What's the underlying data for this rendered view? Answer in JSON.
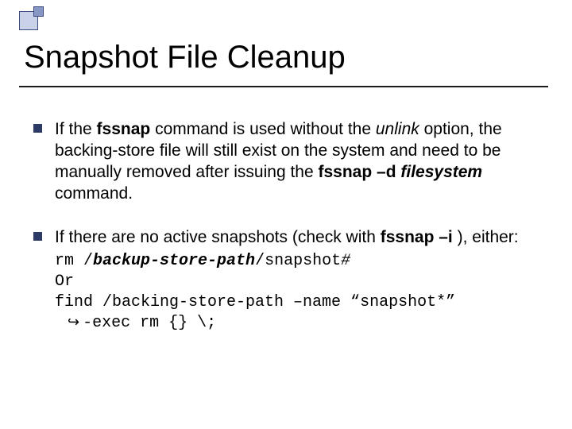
{
  "title": "Snapshot File Cleanup",
  "bullets": [
    {
      "runs": [
        {
          "t": "If the "
        },
        {
          "t": "fssnap"
        },
        {
          "t": " command is used without the "
        },
        {
          "t": "unlink"
        },
        {
          "t": " option, the backing-store file will still exist on the system and need to be manually removed after issuing the "
        },
        {
          "t": "fssnap –d "
        },
        {
          "t": "filesystem"
        },
        {
          "t": " command."
        }
      ]
    },
    {
      "runs": [
        {
          "t": "If there are no active snapshots (check with "
        },
        {
          "t": "fssnap –i"
        },
        {
          "t": "), either:"
        }
      ],
      "code": [
        {
          "runs": [
            {
              "t": "rm /"
            },
            {
              "t": "backup-store-path"
            },
            {
              "t": "/snapshot"
            },
            {
              "t": "#"
            }
          ]
        },
        {
          "runs": [
            {
              "t": "Or"
            }
          ]
        },
        {
          "runs": [
            {
              "t": "find /backing-store-path –name “snapshot*”"
            }
          ]
        },
        {
          "arrow": "↪",
          "runs": [
            {
              "t": "-exec rm {} \\;"
            }
          ]
        }
      ]
    }
  ]
}
